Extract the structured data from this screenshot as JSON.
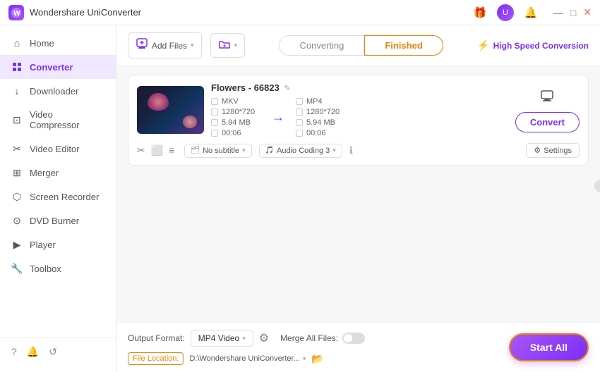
{
  "app": {
    "logo": "W",
    "title": "Wondershare UniConverter"
  },
  "title_bar": {
    "gift_icon": "🎁",
    "avatar_text": "U",
    "bell_icon": "🔔",
    "minimize_icon": "—",
    "maximize_icon": "□",
    "close_icon": "✕"
  },
  "sidebar": {
    "items": [
      {
        "id": "home",
        "label": "Home",
        "icon": "⌂"
      },
      {
        "id": "converter",
        "label": "Converter",
        "icon": "⟳",
        "active": true
      },
      {
        "id": "downloader",
        "label": "Downloader",
        "icon": "↓"
      },
      {
        "id": "video-compressor",
        "label": "Video Compressor",
        "icon": "⊡"
      },
      {
        "id": "video-editor",
        "label": "Video Editor",
        "icon": "✂"
      },
      {
        "id": "merger",
        "label": "Merger",
        "icon": "⊞"
      },
      {
        "id": "screen-recorder",
        "label": "Screen Recorder",
        "icon": "⬡"
      },
      {
        "id": "dvd-burner",
        "label": "DVD Burner",
        "icon": "⊙"
      },
      {
        "id": "player",
        "label": "Player",
        "icon": "▶"
      },
      {
        "id": "toolbox",
        "label": "Toolbox",
        "icon": "⊞"
      }
    ],
    "bottom_icons": [
      "?",
      "🔔",
      "↺"
    ]
  },
  "toolbar": {
    "add_file_label": "Add Files",
    "add_folder_label": "",
    "tab_converting": "Converting",
    "tab_finished": "Finished",
    "high_speed_label": "High Speed Conversion"
  },
  "file_item": {
    "name": "Flowers - 66823",
    "source": {
      "format": "MKV",
      "resolution": "1280*720",
      "size": "5.94 MB",
      "duration": "00:06"
    },
    "output": {
      "format": "MP4",
      "resolution": "1280*720",
      "size": "5.94 MB",
      "duration": "00:06"
    },
    "subtitle": "No subtitle",
    "audio": "Audio Coding 3",
    "convert_btn": "Convert",
    "settings_btn": "Settings"
  },
  "bottom_bar": {
    "output_format_label": "Output Format:",
    "output_format_value": "MP4 Video",
    "merge_label": "Merge All Files:",
    "file_location_label": "File Location:",
    "file_location_path": "D:\\Wondershare UniConverter...",
    "start_all_label": "Start All"
  }
}
